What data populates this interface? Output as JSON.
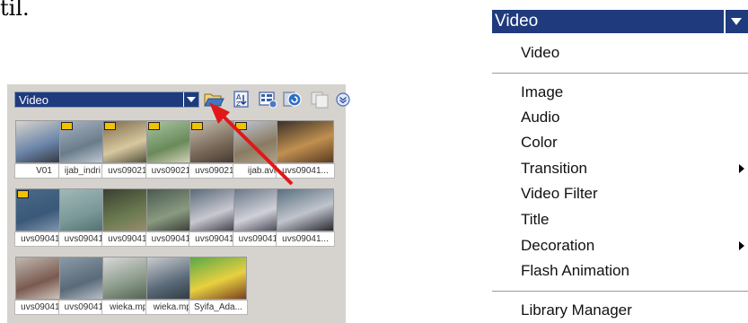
{
  "top_text": "til.",
  "library": {
    "combo_label": "Video",
    "toolbar_icons": [
      "folder-open-icon",
      "sort-icon",
      "view-toggle-icon",
      "library-manager-icon",
      "copy-icon",
      "expand-icon"
    ],
    "thumbnails": [
      {
        "label": "V01",
        "badge": false,
        "colors": [
          "#d8d4cc",
          "#6a84a8",
          "#2a2a30"
        ]
      },
      {
        "label": "ijab_indri ...",
        "badge": true,
        "colors": [
          "#a8b4c4",
          "#6a7c8a",
          "#cfd8e0"
        ]
      },
      {
        "label": "uvs09021...",
        "badge": true,
        "colors": [
          "#7a6a4a",
          "#d8c8a0",
          "#3a3a2a"
        ]
      },
      {
        "label": "uvs09021...",
        "badge": true,
        "colors": [
          "#a9c4a4",
          "#6a8a5a",
          "#e8e0c8"
        ]
      },
      {
        "label": "uvs09021...",
        "badge": true,
        "colors": [
          "#c8c0b0",
          "#7a6a5a",
          "#3a3028"
        ]
      },
      {
        "label": "ijab.avi",
        "badge": true,
        "colors": [
          "#c0c8d8",
          "#8a7a60",
          "#b8a890"
        ]
      },
      {
        "label": "uvs09041...",
        "badge": false,
        "colors": [
          "#3a3028",
          "#c09050",
          "#5a3a20"
        ]
      },
      {
        "label": "uvs09041...",
        "badge": true,
        "colors": [
          "#4a6a8a",
          "#3a5878",
          "#8aa0b8"
        ]
      },
      {
        "label": "uvs09041...",
        "badge": false,
        "colors": [
          "#a0b8b8",
          "#7a9898",
          "#4a6a6a"
        ]
      },
      {
        "label": "uvs09041...",
        "badge": false,
        "colors": [
          "#3a4030",
          "#6a7a50",
          "#a09070"
        ]
      },
      {
        "label": "uvs09041...",
        "badge": false,
        "colors": [
          "#4a5a50",
          "#8a9a80",
          "#2a3028"
        ]
      },
      {
        "label": "uvs09041...",
        "badge": false,
        "colors": [
          "#5a6a7a",
          "#c8c8d0",
          "#2a2a38"
        ]
      },
      {
        "label": "uvs09041...",
        "badge": false,
        "colors": [
          "#6a7888",
          "#d0d0d8",
          "#303040"
        ]
      },
      {
        "label": "uvs09041...",
        "badge": false,
        "colors": [
          "#5a7080",
          "#c0c4cc",
          "#282830"
        ]
      },
      {
        "label": "uvs09041...",
        "badge": false,
        "colors": [
          "#c0b8b0",
          "#7a5a50",
          "#e0d8d0"
        ]
      },
      {
        "label": "uvs09041...",
        "badge": false,
        "colors": [
          "#8a9aa8",
          "#5a6a78",
          "#c8d0d8"
        ]
      },
      {
        "label": "wieka.mpg",
        "badge": false,
        "colors": [
          "#d8d8d8",
          "#8a9a8a",
          "#4a5a4a"
        ]
      },
      {
        "label": "wieka.mpg",
        "badge": false,
        "colors": [
          "#c8ccd0",
          "#5a6a78",
          "#2a3238"
        ]
      },
      {
        "label": "Syifa_Ada...",
        "badge": false,
        "colors": [
          "#5aa848",
          "#e8d040",
          "#7a4020"
        ]
      }
    ]
  },
  "menu": {
    "header": "Video",
    "items": [
      {
        "label": "Video",
        "submenu": false
      },
      {
        "label": "Image",
        "submenu": false
      },
      {
        "label": "Audio",
        "submenu": false
      },
      {
        "label": "Color",
        "submenu": false
      },
      {
        "label": "Transition",
        "submenu": true
      },
      {
        "label": "Video Filter",
        "submenu": false
      },
      {
        "label": "Title",
        "submenu": false
      },
      {
        "label": "Decoration",
        "submenu": true
      },
      {
        "label": "Flash Animation",
        "submenu": false
      },
      {
        "label": "Library Manager",
        "submenu": false
      }
    ]
  },
  "colors": {
    "accent": "#1f3a7d",
    "panel": "#d6d3ce",
    "arrow": "#e01818"
  }
}
